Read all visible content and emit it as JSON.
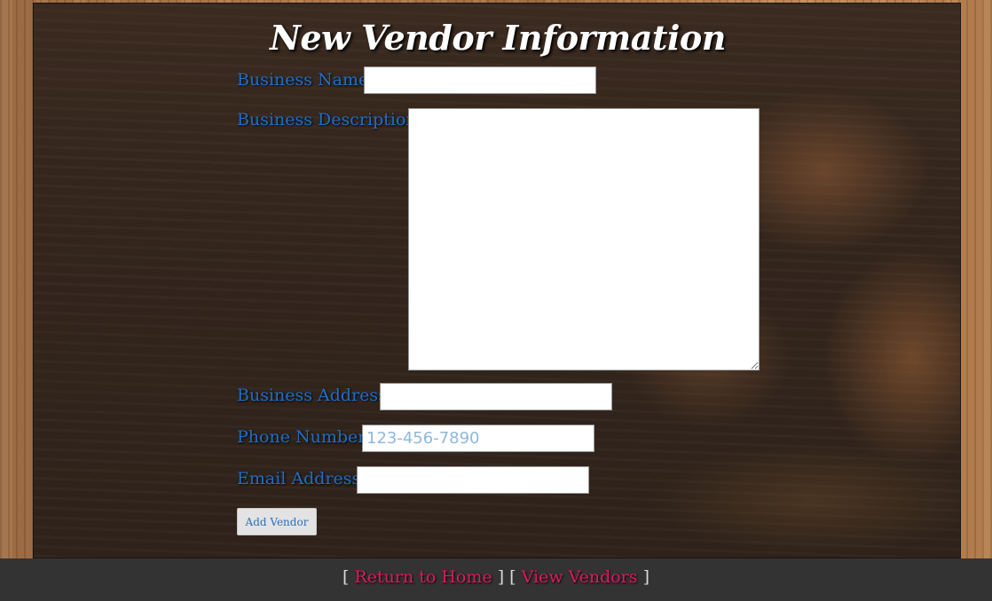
{
  "page": {
    "title": "New Vendor Information"
  },
  "form": {
    "business_name_label": "Business Name",
    "business_name_value": "",
    "business_description_label": "Business Description",
    "business_description_value": "",
    "business_address_label": "Business Address",
    "business_address_value": "",
    "phone_number_label": "Phone Number",
    "phone_number_placeholder": "123-456-7890",
    "email_address_label": "Email Address",
    "email_address_value": "",
    "submit_label": "Add Vendor"
  },
  "footer": {
    "open_bracket_1": "[",
    "return_home_label": "Return to Home",
    "mid_brackets": "] [",
    "view_vendors_label": "View Vendors",
    "close_bracket_2": "]"
  },
  "colors": {
    "label_blue": "#1f6fc8",
    "link_pink": "#e0195f",
    "footer_bg": "#333333"
  }
}
